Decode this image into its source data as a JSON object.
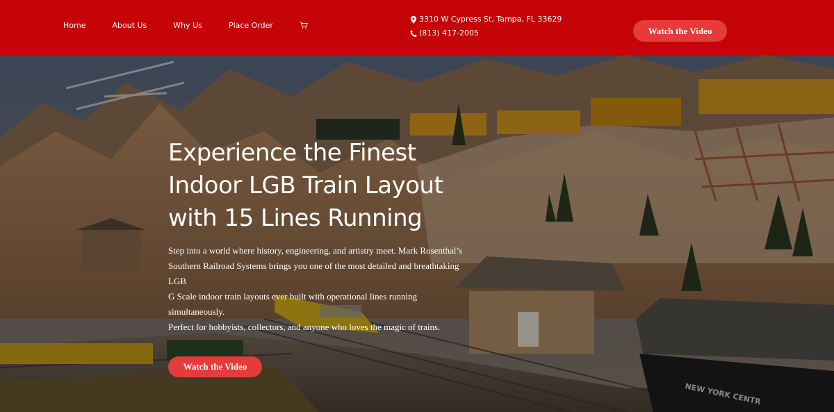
{
  "nav": {
    "items": [
      {
        "label": "Home"
      },
      {
        "label": "About Us"
      },
      {
        "label": "Why Us"
      },
      {
        "label": "Place Order"
      }
    ],
    "cart_icon": "cart-icon"
  },
  "contact": {
    "address": "3310 W Cypress St, Tampa, FL 33629",
    "phone": "(813) 417-2005",
    "address_icon": "map-pin-icon",
    "phone_icon": "phone-icon"
  },
  "header_cta": {
    "label": "Watch the Video"
  },
  "hero": {
    "title_line1": "Experience the Finest",
    "title_line2": "Indoor LGB Train Layout",
    "title_line3": "with 15 Lines Running",
    "text_line1": "Step into a world where history, engineering, and artistry meet. Mark Rosenthal’s",
    "text_line2": "Southern Railroad Systems brings you one of the most detailed and breathtaking LGB",
    "text_line3": "G Scale indoor train layouts ever built with operational lines running simultaneously.",
    "text_line4": "Perfect for hobbyists, collectors, and anyone who loves the magic of trains.",
    "cta_label": "Watch the Video",
    "image_caption_text": "NEW YORK CENTR"
  },
  "colors": {
    "header_bg": "#c40406",
    "button_bg": "#e63b3b",
    "text": "#ffffff"
  }
}
